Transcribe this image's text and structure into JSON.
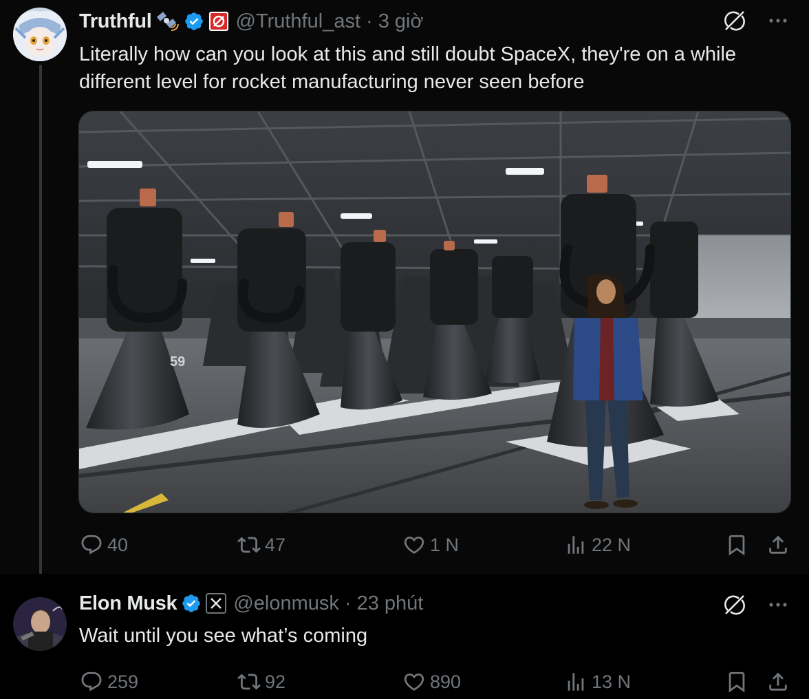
{
  "tweets": [
    {
      "display_name": "Truthful",
      "handle": "@Truthful_ast",
      "separator": "·",
      "time": "3 giờ",
      "text": "Literally how can you look at this and still doubt SpaceX, they're on a while different level for rocket manufacturing never seen before",
      "media": {
        "engine_number_left": "59"
      },
      "stats": {
        "replies": "40",
        "reposts": "47",
        "likes": "1 N",
        "views": "22 N"
      }
    },
    {
      "display_name": "Elon Musk",
      "handle": "@elonmusk",
      "separator": "·",
      "time": "23 phút",
      "text": "Wait until you see what’s coming",
      "stats": {
        "replies": "259",
        "reposts": "92",
        "likes": "890",
        "views": "13 N"
      }
    }
  ],
  "icons": {
    "verified": "verified-badge-icon",
    "satellite": "satellite-emoji-icon",
    "affiliate_red": "red-null-affiliate-icon",
    "affiliate_x": "x-affiliate-icon",
    "grok": "grok-icon",
    "more": "more-dots-icon",
    "reply": "reply-icon",
    "repost": "repost-icon",
    "like": "like-icon",
    "views": "views-icon",
    "bookmark": "bookmark-icon",
    "share": "share-icon"
  },
  "colors": {
    "background": "#000000",
    "text": "#e7e9ea",
    "secondary": "#71767b",
    "verified": "#1d9bf0"
  }
}
